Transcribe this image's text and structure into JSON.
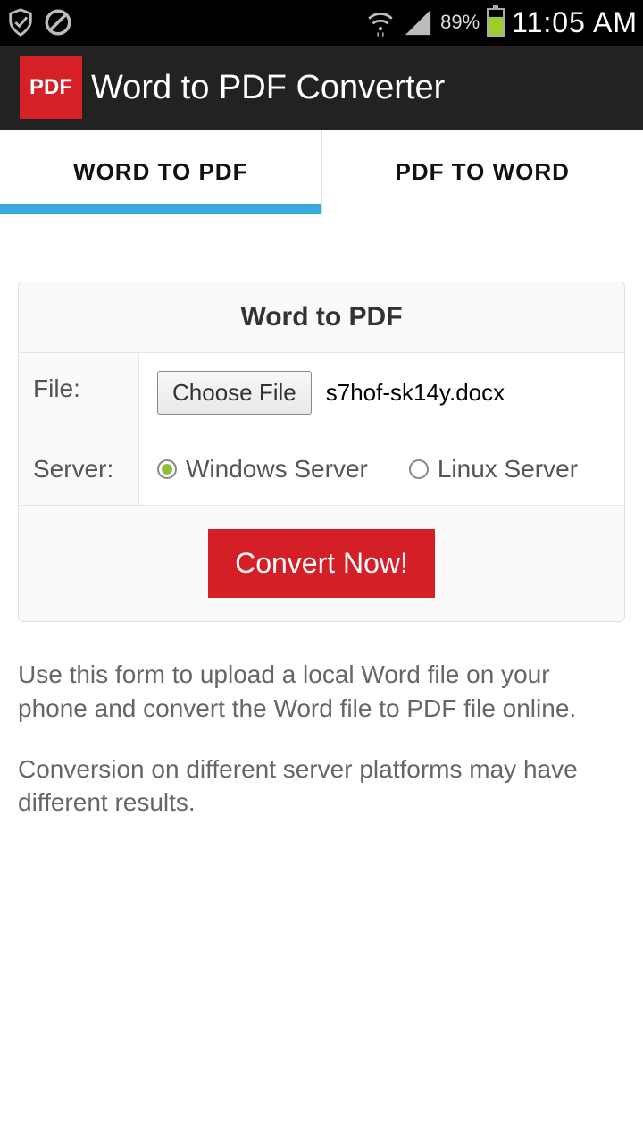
{
  "status": {
    "battery_pct": "89%",
    "time": "11:05 AM"
  },
  "appbar": {
    "icon_text": "PDF",
    "title": "Word to PDF Converter"
  },
  "tabs": [
    {
      "label": "WORD TO PDF",
      "active": true
    },
    {
      "label": "PDF TO WORD",
      "active": false
    }
  ],
  "form": {
    "title": "Word to PDF",
    "file_label": "File:",
    "choose_button": "Choose File",
    "filename": "s7hof-sk14y.docx",
    "server_label": "Server:",
    "server_options": [
      {
        "label": "Windows Server",
        "checked": true
      },
      {
        "label": "Linux Server",
        "checked": false
      }
    ],
    "convert_button": "Convert Now!"
  },
  "descriptions": [
    "Use this form to upload a local Word file on your phone and convert the Word file to PDF file online.",
    "Conversion on different server platforms may have different results."
  ]
}
